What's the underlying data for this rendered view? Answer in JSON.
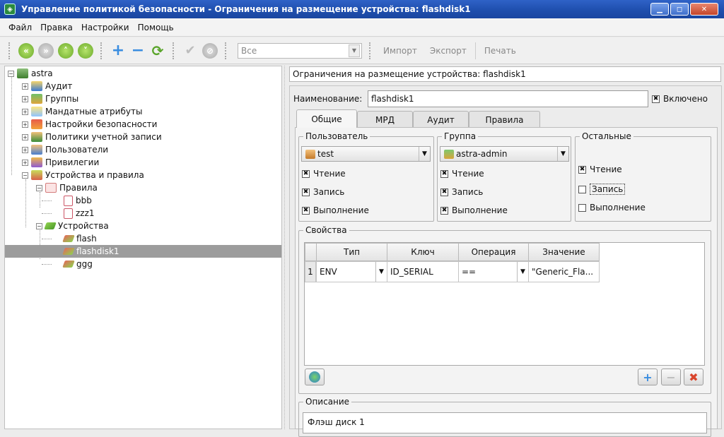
{
  "window": {
    "title": "Управление политикой безопасности - Ограничения на размещение устройства: flashdisk1"
  },
  "menu": [
    "Файл",
    "Правка",
    "Настройки",
    "Помощь"
  ],
  "toolbar": {
    "filter_value": "Все",
    "import_label": "Импорт",
    "export_label": "Экспорт",
    "print_label": "Печать"
  },
  "tree": {
    "root": "astra",
    "items": [
      "Аудит",
      "Группы",
      "Мандатные атрибуты",
      "Настройки безопасности",
      "Политики учетной записи",
      "Пользователи",
      "Привилегии",
      "Устройства и правила"
    ],
    "rules_folder": "Правила",
    "rules": [
      "bbb",
      "zzz1"
    ],
    "devices_folder": "Устройства",
    "devices": [
      "flash",
      "flashdisk1",
      "ggg"
    ],
    "selected": "flashdisk1"
  },
  "right": {
    "header": "Ограничения на размещение устройства: flashdisk1",
    "name_label": "Наименование:",
    "name_value": "flashdisk1",
    "enabled_label": "Включено",
    "enabled": true
  },
  "tabs": [
    "Общие",
    "МРД",
    "Аудит",
    "Правила"
  ],
  "active_tab": "Общие",
  "perm_groups": {
    "user": {
      "legend": "Пользователь",
      "value": "test",
      "read": "Чтение",
      "write": "Запись",
      "exec": "Выполнение"
    },
    "group": {
      "legend": "Группа",
      "value": "astra-admin",
      "read": "Чтение",
      "write": "Запись",
      "exec": "Выполнение"
    },
    "other": {
      "legend": "Остальные",
      "read": "Чтение",
      "write": "Запись",
      "exec": "Выполнение"
    }
  },
  "properties": {
    "legend": "Свойства",
    "columns": [
      "Тип",
      "Ключ",
      "Операция",
      "Значение"
    ],
    "rows": [
      {
        "num": "1",
        "type": "ENV",
        "key": "ID_SERIAL",
        "op": "==",
        "value": "\"Generic_Fla..."
      }
    ]
  },
  "description": {
    "legend": "Описание",
    "value": "Флэш диск 1"
  },
  "colors": {
    "titlebar": "#1f4fae",
    "selection": "#9c9c9c",
    "add_button": "#3a8de0",
    "delete_button": "#d9442b"
  }
}
